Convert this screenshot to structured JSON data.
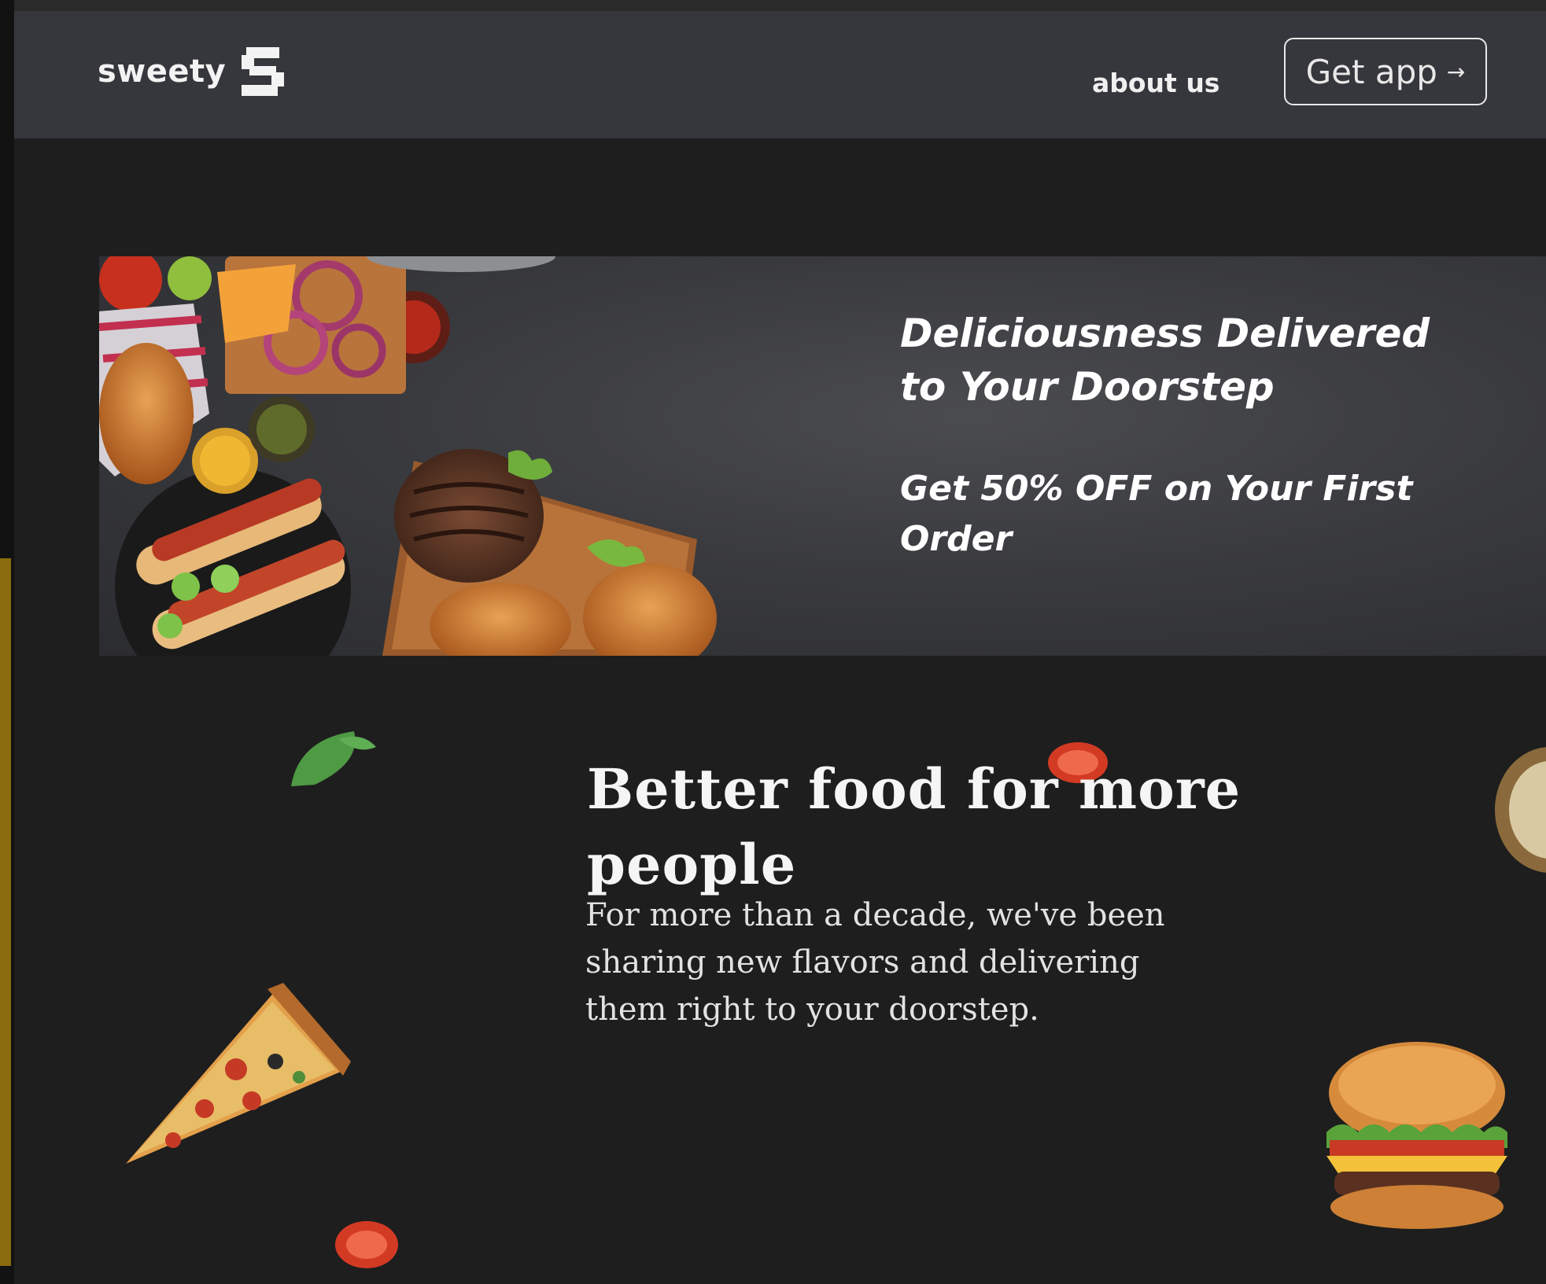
{
  "navbar": {
    "brand_name": "sweety",
    "about_label": "about us",
    "get_app_label": "Get app",
    "get_app_arrow": "→"
  },
  "hero": {
    "title": "Deliciousness Delivered\n to Your Doorstep",
    "offer": "Get 50% OFF on Your First Order"
  },
  "about": {
    "title": "Better food for more people",
    "body": "For more than a decade, we've been sharing new flavors and delivering them right to your doorstep."
  },
  "icons": {
    "brand_logo": "s-logo-icon",
    "arrow": "arrow-right-icon"
  },
  "colors": {
    "page_bg": "#1e1e1e",
    "navbar_bg": "#36373c",
    "accent": "#8b6d10",
    "text": "#ffffff"
  }
}
